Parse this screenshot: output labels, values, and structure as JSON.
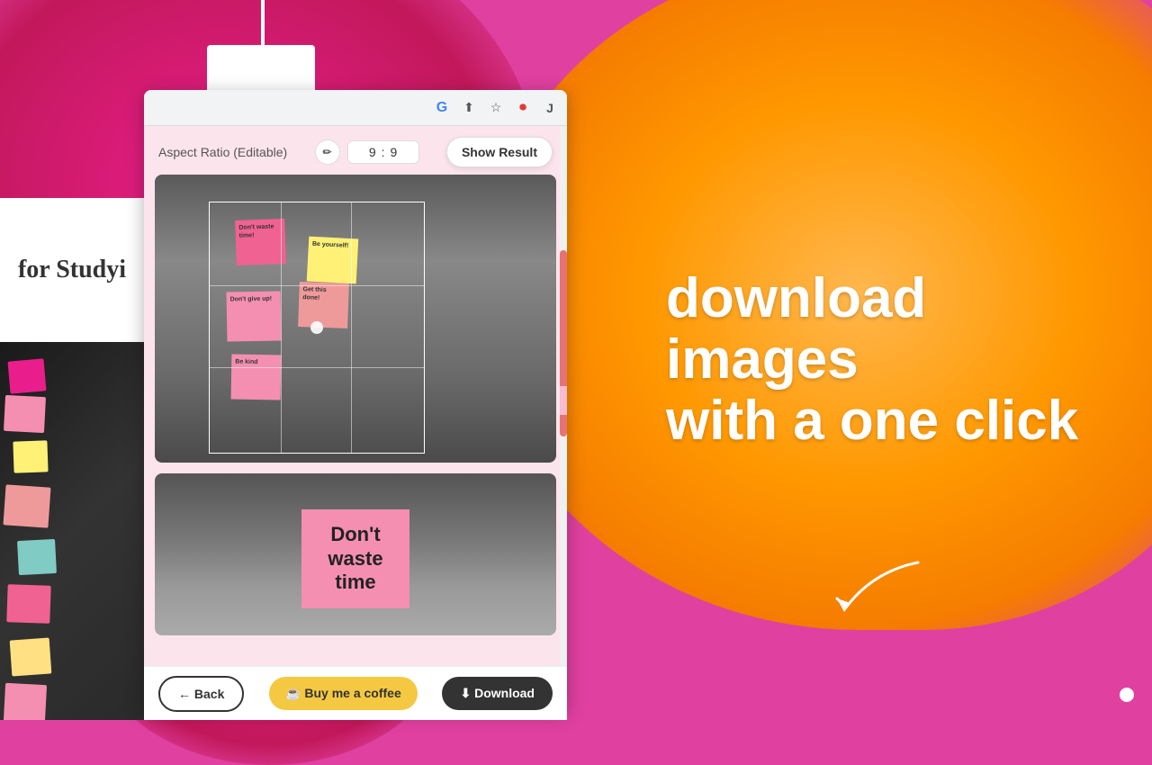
{
  "background": {
    "colors": {
      "pink": "#e040a0",
      "orange": "#ff9800",
      "dark": "#333333"
    }
  },
  "marketing": {
    "headline_line1": "download images",
    "headline_line2": "with a one click"
  },
  "browser": {
    "toolbar_icons": [
      "G",
      "⬆",
      "☆",
      "⏺",
      "J"
    ]
  },
  "popup": {
    "aspect_ratio_label": "Aspect Ratio (Editable)",
    "ratio_value1": "9",
    "ratio_separator": ":",
    "ratio_value2": "9",
    "show_result_label": "Show Result",
    "edit_icon": "✏"
  },
  "bottom_bar": {
    "back_label": "← Back",
    "coffee_label": "☕ Buy me a coffee",
    "download_label": "⬇ Download"
  },
  "sticky_notes": {
    "text1": "Don't waste time!",
    "text2": "Be yourself!",
    "text3": "Don't give up!",
    "text4": "Be kind",
    "text5": "Get this done!",
    "dont_waste_line1": "Don't",
    "dont_waste_line2": "waste",
    "dont_waste_line3": "time"
  },
  "left_sidebar": {
    "text": "for Studyi"
  }
}
